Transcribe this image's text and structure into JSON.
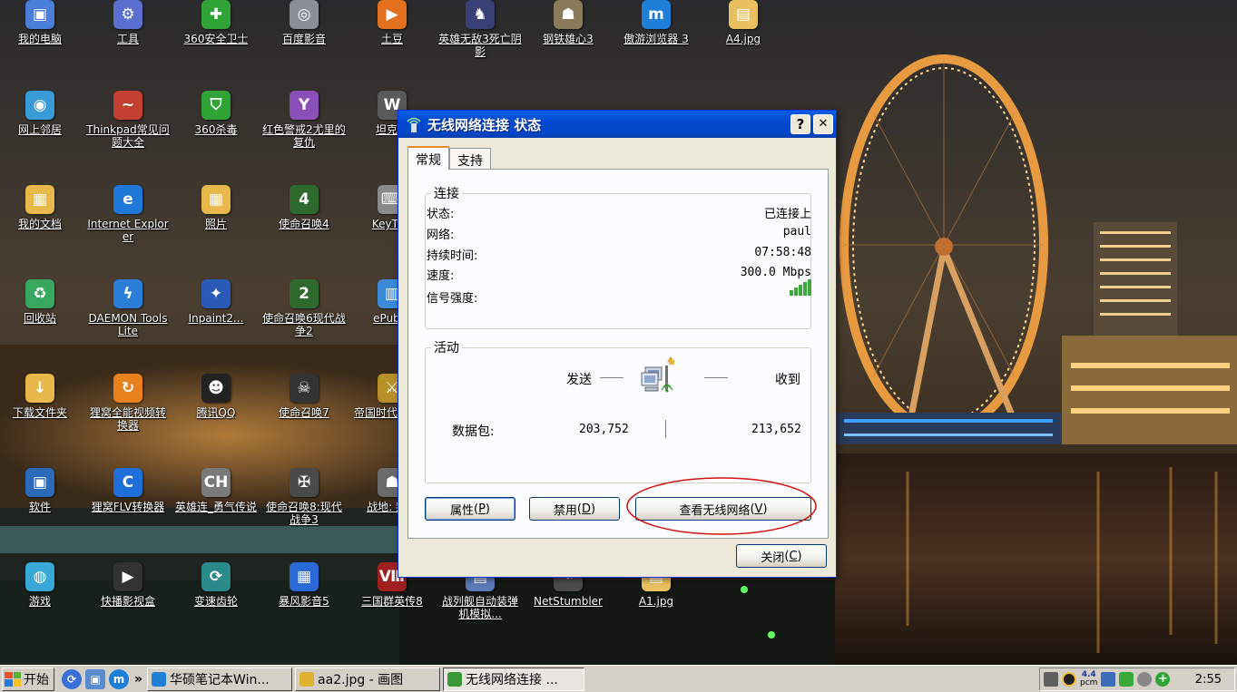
{
  "desktop": {
    "icons": [
      {
        "label": "我的电脑",
        "icon": "my-computer-icon",
        "color": "#4a7ed8",
        "glyph": "▣"
      },
      {
        "label": "工具",
        "icon": "tools-gear-icon",
        "color": "#5a6fd0",
        "glyph": "⚙"
      },
      {
        "label": "360安全卫士",
        "icon": "360-safeguard-icon",
        "color": "#2fa336",
        "glyph": "✚"
      },
      {
        "label": "百度影音",
        "icon": "baidu-player-icon",
        "color": "#8a8f98",
        "glyph": "◎"
      },
      {
        "label": "土豆",
        "icon": "tudou-icon",
        "color": "#e2701c",
        "glyph": "▶"
      },
      {
        "label": "英雄无敌3死亡阴影",
        "icon": "heroes-game-icon",
        "color": "#3a3f76",
        "glyph": "♞"
      },
      {
        "label": "钢铁雄心3",
        "icon": "hearts-of-iron-icon",
        "color": "#8a7a5a",
        "glyph": "☗"
      },
      {
        "label": "傲游浏览器 3",
        "icon": "maxthon-browser-icon",
        "color": "#1e7fd8",
        "glyph": "m"
      },
      {
        "label": "A4.jpg",
        "icon": "jpg-file-icon",
        "color": "#e8c060",
        "glyph": "▤"
      },
      {
        "label": "网上邻居",
        "icon": "network-places-icon",
        "color": "#3a9ad8",
        "glyph": "◉"
      },
      {
        "label": "Thinkpad常见问题大全",
        "icon": "thinkpad-doc-icon",
        "color": "#c44030",
        "glyph": "~"
      },
      {
        "label": "360杀毒",
        "icon": "360-antivirus-icon",
        "color": "#2fa336",
        "glyph": "⛉"
      },
      {
        "label": "红色警戒2尤里的复仇",
        "icon": "red-alert-icon",
        "color": "#8a4fb8",
        "glyph": "Y"
      },
      {
        "label": "坦克世",
        "icon": "world-of-tanks-icon",
        "color": "#5a5a5a",
        "glyph": "W"
      },
      {
        "label": "我的文档",
        "icon": "my-documents-icon",
        "color": "#e8b84a",
        "glyph": "▦"
      },
      {
        "label": "Internet Explorer",
        "icon": "internet-explorer-icon",
        "color": "#1e78d8",
        "glyph": "e"
      },
      {
        "label": "照片",
        "icon": "photos-folder-icon",
        "color": "#e8b84a",
        "glyph": "▦"
      },
      {
        "label": "使命召唤4",
        "icon": "call-of-duty-4-icon",
        "color": "#2e6a2e",
        "glyph": "4"
      },
      {
        "label": "KeyTwe",
        "icon": "keyboard-app-icon",
        "color": "#8a8a8a",
        "glyph": "⌨"
      },
      {
        "label": "回收站",
        "icon": "recycle-bin-icon",
        "color": "#38a860",
        "glyph": "♻"
      },
      {
        "label": "DAEMON Tools Lite",
        "icon": "daemon-tools-icon",
        "color": "#2a7ed8",
        "glyph": "ϟ"
      },
      {
        "label": "Inpaint2...",
        "icon": "inpaint-wand-icon",
        "color": "#2a5ab8",
        "glyph": "✦"
      },
      {
        "label": "使命召唤6现代战争2",
        "icon": "call-of-duty-6-icon",
        "color": "#2e6a2e",
        "glyph": "2"
      },
      {
        "label": "ePub阅",
        "icon": "epub-reader-icon",
        "color": "#3a8ad8",
        "glyph": "▥"
      },
      {
        "label": "下载文件夹",
        "icon": "download-folder-icon",
        "color": "#e8b84a",
        "glyph": "↓"
      },
      {
        "label": "狸窝全能视频转换器",
        "icon": "video-converter-icon",
        "color": "#e8801c",
        "glyph": "↻"
      },
      {
        "label": "腾讯QQ",
        "icon": "qq-penguin-icon",
        "color": "#222222",
        "glyph": "☻"
      },
      {
        "label": "使命召唤7",
        "icon": "call-of-duty-7-icon",
        "color": "#333333",
        "glyph": "☠"
      },
      {
        "label": "帝国时代亚洲王",
        "icon": "age-of-empires-icon",
        "color": "#b8902a",
        "glyph": "⚔"
      },
      {
        "label": "软件",
        "icon": "software-folder-icon",
        "color": "#2a6ab8",
        "glyph": "▣"
      },
      {
        "label": "狸窝FLV转换器",
        "icon": "flv-converter-icon",
        "color": "#1e6fd8",
        "glyph": "C"
      },
      {
        "label": "英雄连_勇气传说",
        "icon": "company-of-heroes-icon",
        "color": "#7a7a7a",
        "glyph": "CH"
      },
      {
        "label": "使命召唤8:现代战争3",
        "icon": "call-of-duty-8-icon",
        "color": "#4a4a4a",
        "glyph": "✠"
      },
      {
        "label": "战地: 叛队",
        "icon": "battlefield-icon",
        "color": "#6a6a6a",
        "glyph": "☗"
      },
      {
        "label": "游戏",
        "icon": "games-folder-icon",
        "color": "#38a8d8",
        "glyph": "◍"
      },
      {
        "label": "快播影视盒",
        "icon": "qvod-player-icon",
        "color": "#333333",
        "glyph": "▶"
      },
      {
        "label": "变速齿轮",
        "icon": "speed-gear-icon",
        "color": "#2a8a8a",
        "glyph": "⟳"
      },
      {
        "label": "暴风影音5",
        "icon": "storm-player-icon",
        "color": "#2a6ad8",
        "glyph": "▦"
      },
      {
        "label": "三国群英传8",
        "icon": "three-kingdoms-icon",
        "color": "#a02020",
        "glyph": "Ⅷ"
      },
      {
        "label": "战列舰自动装弹机模拟...",
        "icon": "battleship-sim-icon",
        "color": "#5a7ab8",
        "glyph": "▤"
      },
      {
        "label": "NetStumbler",
        "icon": "netstumbler-icon",
        "color": "#4a4a4a",
        "glyph": "⌁"
      },
      {
        "label": "A1.jpg",
        "icon": "jpg-file-icon",
        "color": "#e8c060",
        "glyph": "▤"
      }
    ]
  },
  "dialog": {
    "title": "无线网络连接 状态",
    "help_label": "?",
    "close_label": "✕",
    "tabs": [
      "常规",
      "支持"
    ],
    "connection": {
      "group_title": "连接",
      "status_label": "状态:",
      "status_value": "已连接上",
      "network_label": "网络:",
      "network_value": "paul",
      "duration_label": "持续时间:",
      "duration_value": "07:58:48",
      "speed_label": "速度:",
      "speed_value": "300.0 Mbps",
      "signal_label": "信号强度:",
      "signal_bars_lit": 5,
      "signal_bars_total": 5
    },
    "activity": {
      "group_title": "活动",
      "sent_label": "发送",
      "received_label": "收到",
      "packets_label": "数据包:",
      "packets_sent": "203,752",
      "packets_received": "213,652"
    },
    "buttons": {
      "properties_label": "属性",
      "properties_key": "P",
      "disable_label": "禁用",
      "disable_key": "D",
      "view_wireless_label": "查看无线网络",
      "view_wireless_key": "V",
      "close_label": "关闭",
      "close_key": "C"
    },
    "highlight_color": "#d41010"
  },
  "taskbar": {
    "start_label": "开始",
    "tasks": [
      {
        "label": "华硕笔记本Win...",
        "icon": "maxthon-browser-icon",
        "color": "#1e7fd8"
      },
      {
        "label": "aa2.jpg - 画图",
        "icon": "paint-icon",
        "color": "#e0b030"
      },
      {
        "label": "无线网络连接 ...",
        "icon": "wireless-network-icon",
        "color": "#3a9a3a"
      }
    ],
    "tray_pcm": "pcm",
    "clock": "2:55"
  }
}
